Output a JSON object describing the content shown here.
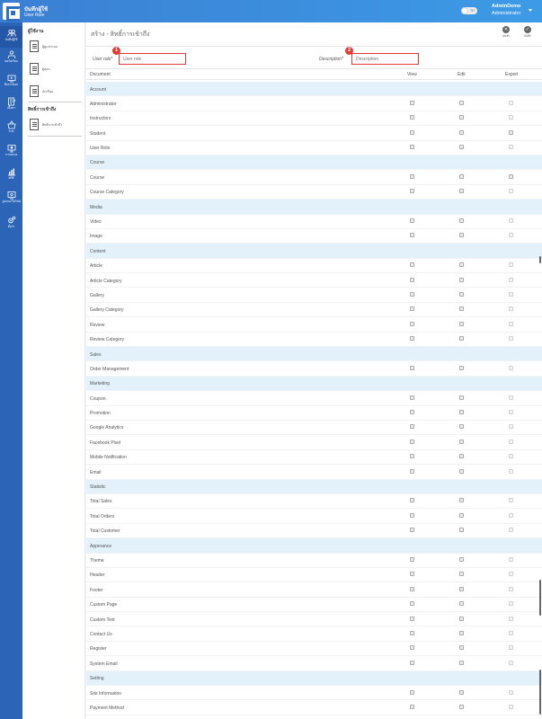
{
  "header": {
    "app_title": "บันทึกผู้ใช้",
    "app_subtitle": "User Role",
    "toggle_label": "TH",
    "user_name": "AdminDemo",
    "user_role": "Administrator"
  },
  "sidebar": {
    "items": [
      {
        "label": "บันทึกผู้ใช้",
        "icon": "users-icon"
      },
      {
        "label": "คอร์สเรียน",
        "icon": "course-icon"
      },
      {
        "label": "สื่อการสอน",
        "icon": "media-icon"
      },
      {
        "label": "เนื้อหา",
        "icon": "content-icon"
      },
      {
        "label": "ขาย",
        "icon": "basket-icon"
      },
      {
        "label": "การตลาด",
        "icon": "marketing-icon"
      },
      {
        "label": "สถิติ",
        "icon": "chart-icon"
      },
      {
        "label": "รูปแบบเว็บไซต์",
        "icon": "website-icon"
      },
      {
        "label": "ตั้งค่า",
        "icon": "settings-icon"
      }
    ]
  },
  "subpanel": {
    "section1_title": "ผู้ใช้งาน",
    "section1_items": [
      {
        "label": "ผู้ดูแลระบบ"
      },
      {
        "label": "ผู้สอน"
      },
      {
        "label": "นักเรียน"
      }
    ],
    "section2_title": "สิทธิ์การเข้าถึง",
    "section2_items": [
      {
        "label": "สิทธิ์การเข้าถึง"
      }
    ]
  },
  "main": {
    "title": "สร้าง - สิทธิ์การเข้าถึง",
    "cancel_label": "ยกเลิก",
    "save_label": "บันทึก",
    "user_role_label": "User role*",
    "user_role_placeholder": "User role",
    "description_label": "Description*",
    "description_placeholder": "Description",
    "badge1": "1",
    "badge2": "2",
    "col_document": "Document",
    "col_view": "View",
    "col_edit": "Edit",
    "col_export": "Export"
  },
  "permission_rows": [
    {
      "group": "Account"
    },
    {
      "name": "Administrator",
      "export_disabled": true
    },
    {
      "name": "Instructors",
      "export_disabled": true
    },
    {
      "name": "Student",
      "export_disabled": false
    },
    {
      "name": "User Role",
      "export_disabled": true
    },
    {
      "group": "Course"
    },
    {
      "name": "Course",
      "export_disabled": false
    },
    {
      "name": "Course Category",
      "export_disabled": true
    },
    {
      "group": "Media"
    },
    {
      "name": "Video",
      "export_disabled": true
    },
    {
      "name": "Image",
      "export_disabled": true
    },
    {
      "group": "Content"
    },
    {
      "name": "Article",
      "export_disabled": true
    },
    {
      "name": "Article Category",
      "export_disabled": true
    },
    {
      "name": "Gallery",
      "export_disabled": true
    },
    {
      "name": "Gallery Category",
      "export_disabled": true
    },
    {
      "name": "Review",
      "export_disabled": true
    },
    {
      "name": "Review Category",
      "export_disabled": true
    },
    {
      "group": "Sales"
    },
    {
      "name": "Order Management",
      "export_disabled": true
    },
    {
      "group": "Marketing"
    },
    {
      "name": "Coupon",
      "export_disabled": true
    },
    {
      "name": "Promotion",
      "export_disabled": true
    },
    {
      "name": "Google Analytics",
      "export_disabled": true
    },
    {
      "name": "Facebook Pixel",
      "export_disabled": true
    },
    {
      "name": "Mobile Notification",
      "export_disabled": true
    },
    {
      "name": "Email",
      "export_disabled": true
    },
    {
      "group": "Statistic"
    },
    {
      "name": "Total Sales",
      "export_disabled": true
    },
    {
      "name": "Total Orders",
      "export_disabled": true
    },
    {
      "name": "Total Customer",
      "export_disabled": true
    },
    {
      "group": "Apperance"
    },
    {
      "name": "Theme",
      "export_disabled": true
    },
    {
      "name": "Header",
      "export_disabled": true
    },
    {
      "name": "Footer",
      "export_disabled": true
    },
    {
      "name": "Custom Page",
      "export_disabled": true
    },
    {
      "name": "Custom Text",
      "export_disabled": true
    },
    {
      "name": "Contact Us",
      "export_disabled": true
    },
    {
      "name": "Register",
      "export_disabled": true
    },
    {
      "name": "System Email",
      "export_disabled": true
    },
    {
      "group": "Setting"
    },
    {
      "name": "Site Information",
      "export_disabled": true
    },
    {
      "name": "Payment Method",
      "export_disabled": true
    }
  ]
}
